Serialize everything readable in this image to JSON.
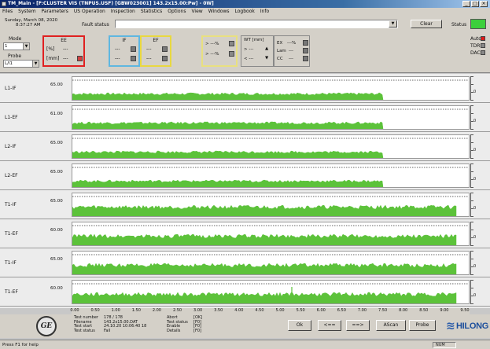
{
  "window": {
    "title": "TM_Main - [F:CLUSTER VIS (TNPUS.USF)  [GBW023001]     143.2x15.00:Pw]  - 0W]",
    "controls": [
      "_",
      "□",
      "×"
    ]
  },
  "menu": [
    "Files",
    "System",
    "Parameters",
    "US Operation",
    "Inspection",
    "Statistics",
    "Options",
    "View",
    "Windows",
    "Logbook",
    "Info"
  ],
  "header": {
    "date": "Sunday, March 08, 2020",
    "time": "8:37:27 AM",
    "fault_label": "Fault status",
    "fault_value": "",
    "clear_label": "Clear",
    "status_label": "Status",
    "status_color": "#3cd03c"
  },
  "mode": {
    "label": "Mode",
    "value": "1"
  },
  "probe": {
    "label": "Probe",
    "value": "L/I1"
  },
  "groups": {
    "ee": {
      "title": "EE",
      "pct_label": "[%]",
      "pct_value": "---",
      "mm_label": "[mm]",
      "mm_value": "---",
      "border": "#e02020"
    },
    "if": {
      "title": "IF",
      "value1": "---",
      "value2": "---",
      "border": "#5fb7e0"
    },
    "ef": {
      "title": "EF",
      "value1": "---",
      "value2": "---",
      "border": "#e8d840"
    },
    "pct": {
      "row1": "> ---%",
      "row2": "> ---%",
      "border": "#e8e080"
    },
    "wt": {
      "title": "WT [mm]",
      "row1": "> ---",
      "row2": "< ---"
    },
    "ex": {
      "ex_label": "EX",
      "ex_value": "---%",
      "lam_label": "Lam",
      "lam_value": "---",
      "cc_label": "CC",
      "cc_value": "---"
    }
  },
  "indicators": [
    {
      "label": "Auto",
      "color": "#e01818"
    },
    {
      "label": "TDR",
      "color": "#888888"
    },
    {
      "label": "DAC",
      "color": "#888888"
    }
  ],
  "channels": [
    {
      "name": "L1-IF",
      "threshold": "65.00",
      "scale": "0"
    },
    {
      "name": "L1-EF",
      "threshold": "61.00",
      "scale": "0"
    },
    {
      "name": "L2-IF",
      "threshold": "65.00",
      "scale": "0"
    },
    {
      "name": "L2-EF",
      "threshold": "65.00",
      "scale": "0"
    },
    {
      "name": "T1-IF",
      "threshold": "65.00",
      "scale": "0"
    },
    {
      "name": "T1-EF",
      "threshold": "60.00",
      "scale": "0"
    },
    {
      "name": "T1-IF",
      "threshold": "65.00",
      "scale": "0"
    },
    {
      "name": "T1-EF",
      "threshold": "60.00",
      "scale": "0"
    }
  ],
  "signal_color": "#5cc23a",
  "x_axis": [
    "0.00",
    "0.50",
    "1.00",
    "1.50",
    "2.00",
    "2.50",
    "3.00",
    "3.50",
    "4.00",
    "4.50",
    "5.00",
    "5.50",
    "6.00",
    "6.50",
    "7.00",
    "7.50",
    "8.00",
    "8.50",
    "9.00",
    "9.50"
  ],
  "test_info": {
    "col1_labels": [
      "Test number",
      "Filename",
      "Test start",
      "Test status"
    ],
    "col1_values": [
      "178 / 178",
      "143.2x15.00.DAT",
      "24.10.20 10:06:40 18",
      "Fail"
    ],
    "col2_labels": [
      "Abort",
      "Test status",
      "Enable",
      "Details"
    ],
    "col2_values": [
      "[OK]",
      "[F0]",
      "[F0]",
      "[F0]"
    ]
  },
  "buttons": {
    "ok": "Ok",
    "back": "<==",
    "forward": "==>",
    "ascan": "AScan",
    "probe": "Probe"
  },
  "logos": {
    "ge": "GE",
    "brand": "HILONG"
  },
  "statusbar": {
    "help": "Press F1 for help",
    "num": "NUM"
  }
}
